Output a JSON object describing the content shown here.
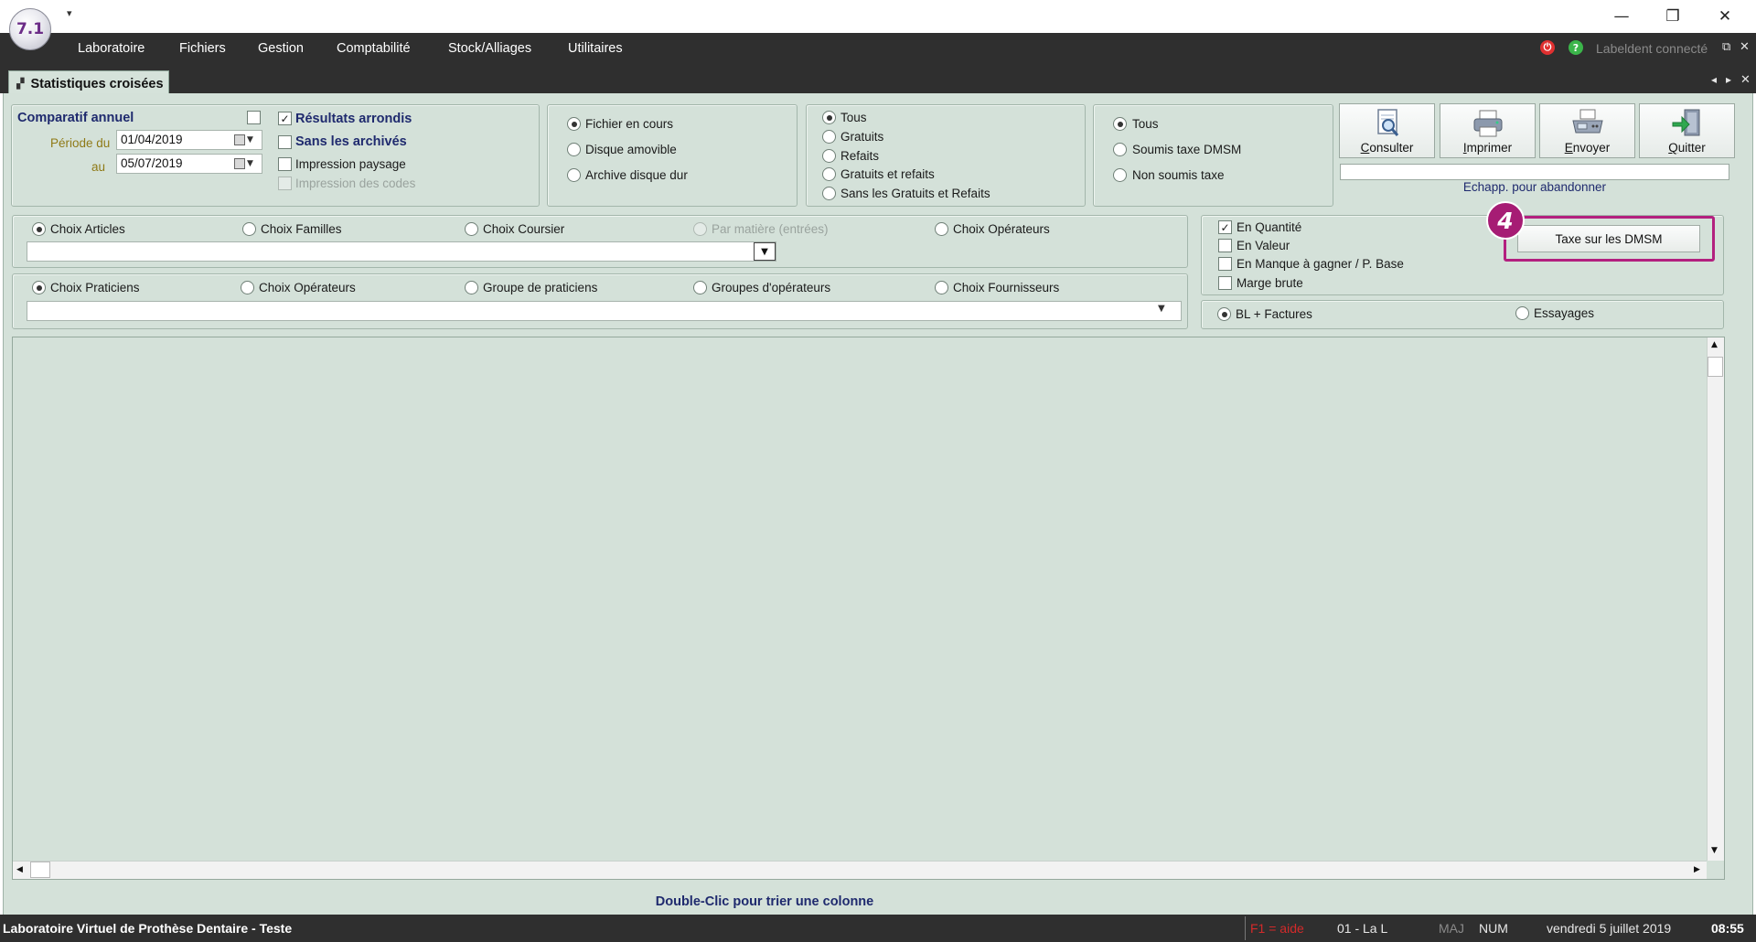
{
  "app": {
    "logo_text": "7.1",
    "quick_access": "▾"
  },
  "window_controls": {
    "minimize": "—",
    "restore": "❐",
    "close": "✕"
  },
  "menu": [
    "Laboratoire",
    "Fichiers",
    "Gestion",
    "Comptabilité",
    "Stock/Alliages",
    "Utilitaires"
  ],
  "connection": {
    "status_text": "Labeldent connecté",
    "power_color": "#e03030",
    "help_color": "#3bb54a",
    "help_glyph": "?",
    "power_glyph": "⏻"
  },
  "tab": {
    "label": "Statistiques croisées",
    "icon": "chart-icon"
  },
  "period": {
    "comparatif_label": "Comparatif annuel",
    "from_label": "Période du",
    "to_label": "au",
    "from_value": "01/04/2019",
    "to_value": "05/07/2019"
  },
  "options": {
    "resultats_arrondis": "Résultats arrondis",
    "sans_archives": "Sans les archivés",
    "impression_paysage": "Impression paysage",
    "impression_codes": "Impression des codes"
  },
  "source": [
    "Fichier en cours",
    "Disque amovible",
    "Archive disque dur"
  ],
  "type_filter": [
    "Tous",
    "Gratuits",
    "Refaits",
    "Gratuits et refaits",
    "Sans les Gratuits et Refaits"
  ],
  "tax_filter": [
    "Tous",
    "Soumis taxe DMSM",
    "Non soumis taxe"
  ],
  "toolbar": {
    "consulter_first": "C",
    "consulter_rest": "onsulter",
    "imprimer_first": "I",
    "imprimer_rest": "mprimer",
    "envoyer_first": "E",
    "envoyer_rest": "nvoyer",
    "quitter_first": "Q",
    "quitter_rest": "uitter",
    "escape_hint": "Echapp. pour abandonner"
  },
  "articles_choices": [
    "Choix Articles",
    "Choix Familles",
    "Choix Coursier",
    "Par matière (entrées)",
    "Choix Opérateurs"
  ],
  "praticiens_choices": [
    "Choix Praticiens",
    "Choix Opérateurs",
    "Groupe de praticiens",
    "Groupes d'opérateurs",
    "Choix Fournisseurs"
  ],
  "measures": [
    "En Quantité",
    "En Valeur",
    "En Manque à gagner / P. Base",
    "Marge brute"
  ],
  "dmsm_button": "Taxe sur les DMSM",
  "step_badge": "4",
  "doc_type": [
    "BL + Factures",
    "Essayages"
  ],
  "grid_hint": "Double-Clic pour trier une colonne",
  "status": {
    "lab_name": "Laboratoire Virtuel de Prothèse Dentaire - Teste",
    "help_key": "F1 = aide",
    "site": "01 - La L",
    "caps": "MAJ",
    "num": "NUM",
    "date": "vendredi 5 juillet 2019",
    "time": "08:55"
  }
}
